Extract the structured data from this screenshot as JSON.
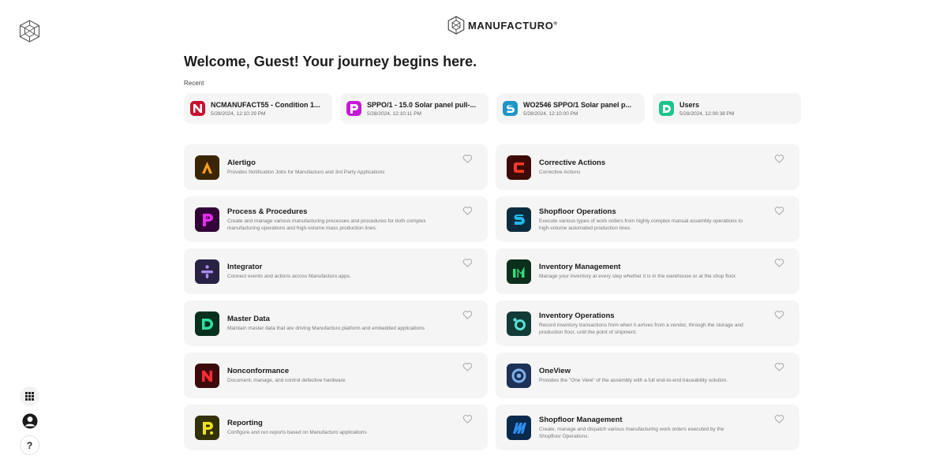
{
  "brand": {
    "name": "MANUFACTURO",
    "reg": "®"
  },
  "welcome": "Welcome, Guest! Your journey begins here.",
  "recent_label": "Recent",
  "recent": [
    {
      "title": "NCMANUFACT55 - Condition 1...",
      "date": "5/28/2024, 12:10:29 PM",
      "color": "#c8102e",
      "glyph": "N"
    },
    {
      "title": "SPPO/1 - 15.0 Solar panel pull-...",
      "date": "5/28/2024, 12:10:11 PM",
      "color": "#c41ad6",
      "glyph": "P"
    },
    {
      "title": "WO2546 SPPO/1 Solar panel p...",
      "date": "5/28/2024, 12:10:00 PM",
      "color": "#1e96c8",
      "glyph": "S"
    },
    {
      "title": "Users",
      "date": "5/28/2024, 12:09:38 PM",
      "color": "#1cc48a",
      "glyph": "D"
    }
  ],
  "apps": [
    {
      "title": "Alertigo",
      "desc": "Provides Notification Jobs for Manufacturo and 3rd Party Applications",
      "bg": "#3a2604",
      "fg": "#ff9f1a",
      "icon": "alertigo-icon"
    },
    {
      "title": "Corrective Actions",
      "desc": "Corrective Actions",
      "bg": "#3d0a08",
      "fg": "#ff3b25",
      "icon": "corrective-actions-icon"
    },
    {
      "title": "Process & Procedures",
      "desc": "Create and manage various manufacturing processes and procedures for both complex manufacturing operations and high-volume mass production lines.",
      "bg": "#330438",
      "fg": "#e52df3",
      "icon": "process-procedures-icon"
    },
    {
      "title": "Shopfloor Operations",
      "desc": "Execute various types of work orders from highly complex manual assembly operations to high-volume automated production lines.",
      "bg": "#0a2c3e",
      "fg": "#22b6e8",
      "icon": "shopfloor-operations-icon"
    },
    {
      "title": "Integrator",
      "desc": "Connect events and actions across Manufacturo apps.",
      "bg": "#2a2244",
      "fg": "#a98cf2",
      "icon": "integrator-icon"
    },
    {
      "title": "Inventory Management",
      "desc": "Manage your inventory at every step whether it is in the warehouse or at the shop floor.",
      "bg": "#0b2f1a",
      "fg": "#33e07a",
      "icon": "inventory-management-icon"
    },
    {
      "title": "Master Data",
      "desc": "Maintain master data that are driving Manufacturo platform and embedded applications",
      "bg": "#08301f",
      "fg": "#2ee0a0",
      "icon": "master-data-icon"
    },
    {
      "title": "Inventory Operations",
      "desc": "Record inventory transactions from when it arrives from a vendor, through the storage and production floor, until the point of shipment.",
      "bg": "#123a36",
      "fg": "#5ae0d2",
      "icon": "inventory-operations-icon"
    },
    {
      "title": "Nonconformance",
      "desc": "Document, manage, and control defective hardware.",
      "bg": "#3d0a0c",
      "fg": "#ff2b35",
      "icon": "nonconformance-icon"
    },
    {
      "title": "OneView",
      "desc": "Provides the \"One View\" of the assembly with a full end-to-end traceability solution.",
      "bg": "#1d3256",
      "fg": "#7fb0ee",
      "icon": "oneview-icon"
    },
    {
      "title": "Reporting",
      "desc": "Configure and run reports based on Manufacturo applications",
      "bg": "#333108",
      "fg": "#f2e21e",
      "icon": "reporting-icon"
    },
    {
      "title": "Shopfloor Management",
      "desc": "Create, manage and dispatch various manufacturing work orders executed by the Shopfloor Operations.",
      "bg": "#0a2a4d",
      "fg": "#2f8ff0",
      "icon": "shopfloor-management-icon"
    }
  ]
}
